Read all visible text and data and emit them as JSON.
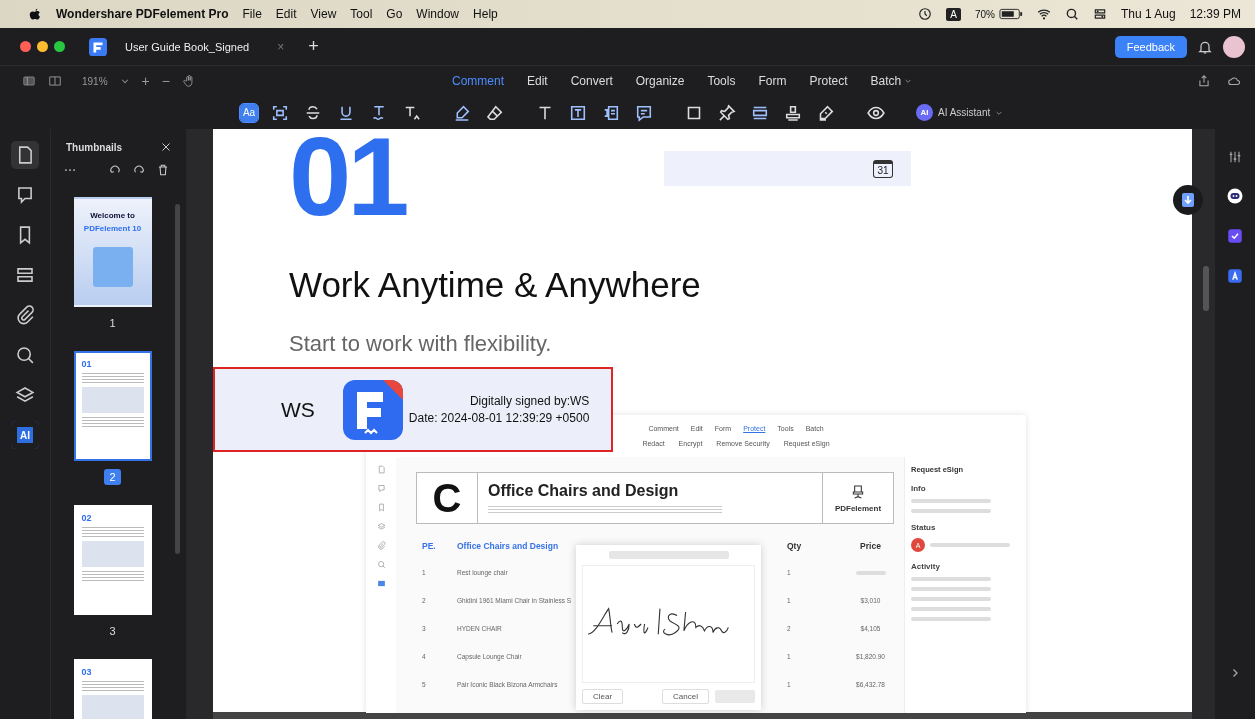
{
  "menubar": {
    "app": "Wondershare PDFelement Pro",
    "menus": [
      "File",
      "Edit",
      "View",
      "Tool",
      "Go",
      "Window",
      "Help"
    ],
    "input_source": "A",
    "battery": "70%",
    "date": "Thu 1 Aug",
    "time": "12:39 PM"
  },
  "tabbar": {
    "tabs": [
      {
        "label": "User Guide Book_Signed",
        "selected": true
      }
    ],
    "close": "×",
    "new_tab": "+",
    "feedback": "Feedback"
  },
  "toolbar": {
    "zoom": "191%",
    "zoom_in": "+",
    "zoom_out": "−",
    "tabs": [
      {
        "label": "Comment",
        "selected": true,
        "menu": false
      },
      {
        "label": "Edit",
        "selected": false,
        "menu": false
      },
      {
        "label": "Convert",
        "selected": false,
        "menu": false
      },
      {
        "label": "Organize",
        "selected": false,
        "menu": false
      },
      {
        "label": "Tools",
        "selected": false,
        "menu": false
      },
      {
        "label": "Form",
        "selected": false,
        "menu": false
      },
      {
        "label": "Protect",
        "selected": false,
        "menu": false
      },
      {
        "label": "Batch",
        "selected": false,
        "menu": true
      }
    ]
  },
  "tools": [
    {
      "kind": "aa",
      "label": "Aa",
      "selected": true
    },
    {
      "kind": "area",
      "selected": false
    },
    {
      "kind": "strike",
      "selected": false
    },
    {
      "kind": "underline",
      "selected": false
    },
    {
      "kind": "squiggle",
      "selected": false
    },
    {
      "kind": "caret",
      "selected": false
    },
    {
      "kind": "highlight",
      "selected": false
    },
    {
      "kind": "eraser",
      "selected": false
    },
    {
      "kind": "text",
      "selected": false
    },
    {
      "kind": "textbox",
      "selected": false
    },
    {
      "kind": "callout",
      "selected": false
    },
    {
      "kind": "note",
      "selected": false
    },
    {
      "kind": "rect",
      "selected": false
    },
    {
      "kind": "pin",
      "selected": false
    },
    {
      "kind": "measure",
      "selected": false
    },
    {
      "kind": "stamp",
      "selected": false
    },
    {
      "kind": "sign",
      "selected": false
    },
    {
      "kind": "eye",
      "selected": false
    }
  ],
  "ai_assistant": {
    "badge": "AI",
    "label": "AI Assistant"
  },
  "left_rail": [
    {
      "kind": "page",
      "selected": true
    },
    {
      "kind": "comment",
      "selected": false
    },
    {
      "kind": "bookmark",
      "selected": false
    },
    {
      "kind": "stack",
      "selected": false
    },
    {
      "kind": "clip",
      "selected": false
    },
    {
      "kind": "search",
      "selected": false
    },
    {
      "kind": "layers",
      "selected": false
    },
    {
      "kind": "ai",
      "label": "AI",
      "selected": false
    }
  ],
  "thumbnails": {
    "title": "Thumbnails",
    "pages": [
      {
        "kind": "cover",
        "heading": "Welcome to",
        "subheading": "PDFelement 10",
        "number": "1",
        "selected": false
      },
      {
        "kind": "chapter",
        "heading": "01",
        "number": "2",
        "selected": true
      },
      {
        "kind": "chapter",
        "heading": "02",
        "number": "3",
        "selected": false
      },
      {
        "kind": "chapter",
        "heading": "03",
        "selected": false
      }
    ]
  },
  "page": {
    "number": "01",
    "calendar_day": "31",
    "title": "Work Anytime & Anywhere",
    "subtitle": "Start to work with flexibility.",
    "signature": {
      "initials": "WS",
      "signed_by": "Digitally signed by:WS",
      "date": "Date: 2024-08-01 12:39:29 +0500"
    },
    "screenshot": {
      "menu": [
        {
          "label": "Comment",
          "selected": false
        },
        {
          "label": "Edit",
          "selected": false
        },
        {
          "label": "Form",
          "selected": false
        },
        {
          "label": "Protect",
          "selected": true
        },
        {
          "label": "Tools",
          "selected": false
        },
        {
          "label": "Batch",
          "selected": false
        }
      ],
      "actions": [
        "Redact",
        "Encrypt",
        "Remove Security",
        "Request eSign"
      ],
      "letter": "C",
      "doc_title": "Office Chairs and Design",
      "brand": "PDFelement",
      "columns": [
        "PE.",
        "Office Chairs and Design",
        "Qty",
        "Price"
      ],
      "rows": [
        {
          "no": "1",
          "item": "Rest lounge chair",
          "qty": "1"
        },
        {
          "no": "2",
          "item": "Ghidini 1961 Miami Chair in Stainless S",
          "qty": "1",
          "price": "$3,010"
        },
        {
          "no": "3",
          "item": "HYDEN CHAIR",
          "qty": "2",
          "price": "$4,105"
        },
        {
          "no": "4",
          "item": "Capsule Lounge Chair",
          "qty": "1",
          "price": "$1,820.90"
        },
        {
          "no": "5",
          "item": "Pair Iconic Black Bizona Armchairs",
          "qty": "1",
          "price": "$6,432.78"
        }
      ],
      "dialog": {
        "clear": "Clear",
        "cancel": "Cancel"
      },
      "panel": {
        "title": "Request eSign",
        "sections": [
          "Info",
          "Status",
          "Activity"
        ],
        "avatar": "A"
      }
    }
  }
}
